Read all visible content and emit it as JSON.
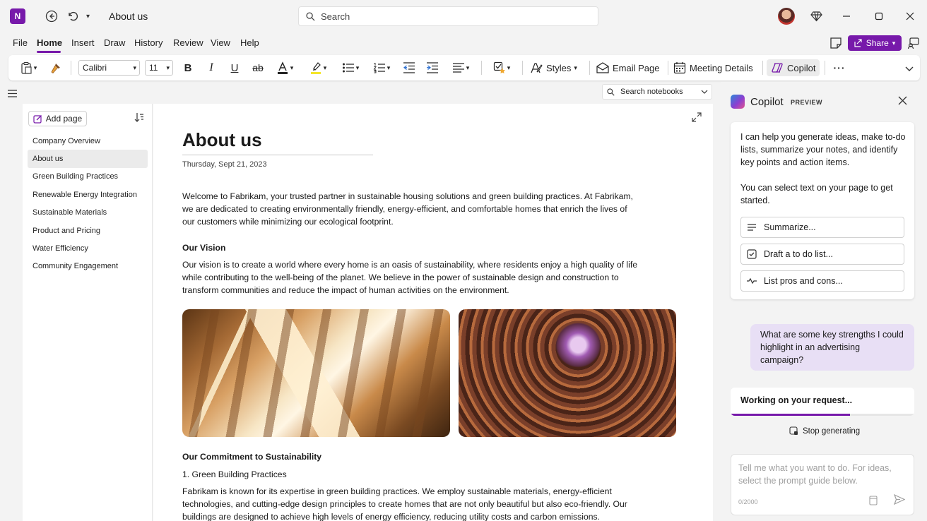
{
  "titlebar": {
    "app_icon_text": "N",
    "doc_title": "About us",
    "search_placeholder": "Search"
  },
  "menu": {
    "items": [
      "File",
      "Home",
      "Insert",
      "Draw",
      "History",
      "Review",
      "View",
      "Help"
    ],
    "active": "Home",
    "share_label": "Share"
  },
  "ribbon": {
    "font_name": "Calibri",
    "font_size": "11",
    "styles_label": "Styles",
    "email_page_label": "Email Page",
    "meeting_details_label": "Meeting Details",
    "copilot_label": "Copilot",
    "more": "···"
  },
  "pages": {
    "add_page_label": "Add page",
    "items": [
      "Company Overview",
      "About us",
      "Green Building Practices",
      "Renewable Energy Integration",
      "Sustainable Materials",
      "Product and Pricing",
      "Water Efficiency",
      "Community Engagement"
    ],
    "selected": "About us"
  },
  "page": {
    "title": "About us",
    "date": "Thursday, Sept 21, 2023",
    "intro": "Welcome to Fabrikam, your trusted partner in sustainable housing solutions and green building practices. At Fabrikam, we are dedicated to creating environmentally friendly, energy-efficient, and comfortable homes that enrich the lives of our customers while minimizing our ecological footprint.",
    "vision_heading": "Our Vision",
    "vision_text": "Our vision is to create a world where every home is an oasis of sustainability, where residents enjoy a high quality of life while contributing to the well-being of the planet. We believe in the power of sustainable design and construction to transform communities and reduce the impact of human activities on the environment.",
    "commitment_heading": "Our Commitment to Sustainability",
    "commitment_sub": "1. Green Building Practices",
    "commitment_text": "Fabrikam is known for its expertise in green building practices. We employ sustainable materials, energy-efficient technologies, and cutting-edge design principles to create homes that are not only beautiful but also eco-friendly. Our buildings are designed to achieve high levels of energy efficiency, reducing utility costs and carbon emissions."
  },
  "search_notebooks": {
    "placeholder": "Search notebooks"
  },
  "copilot": {
    "title": "Copilot",
    "badge": "PREVIEW",
    "intro": "I can help you generate ideas, make to-do lists, summarize your notes, and identify key points and action items.",
    "intro2": "You can select text on your page to get started.",
    "suggestions": [
      "Summarize...",
      "Draft a to do list...",
      "List pros and cons..."
    ],
    "user_message": "What are some key strengths I could highlight in an advertising campaign?",
    "working_text": "Working on your request...",
    "progress": 0.65,
    "stop_label": "Stop generating",
    "prompt_placeholder": "Tell me what you want to do. For ideas, select the prompt guide below.",
    "char_count": "0/2000"
  },
  "colors": {
    "accent": "#7719aa",
    "user_bubble": "#e8dff5"
  }
}
